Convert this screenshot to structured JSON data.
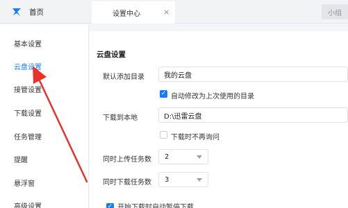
{
  "topbar": {
    "home_label": "首页",
    "tab_label": "设置中心",
    "tab_close": "×",
    "user_button": "小组"
  },
  "sidebar": {
    "items": [
      {
        "label": "基本设置"
      },
      {
        "label": "云盘设置"
      },
      {
        "label": "接管设置"
      },
      {
        "label": "下载设置"
      },
      {
        "label": "任务管理"
      },
      {
        "label": "提醒"
      },
      {
        "label": "悬浮窗"
      },
      {
        "label": "高级设置"
      }
    ],
    "active_index": 1
  },
  "cloud_settings": {
    "title": "云盘设置",
    "default_add_dir": {
      "label": "默认添加目录",
      "value": "我的云盘"
    },
    "auto_update_last_dir": {
      "label": "自动修改为上次使用的目录",
      "checked": true
    },
    "download_to_local": {
      "label": "下载到本地",
      "value": "D:\\迅雷云盘"
    },
    "no_ask_on_download": {
      "label": "下载时不再询问",
      "checked": false
    },
    "concurrent_uploads": {
      "label": "同时上传任务数",
      "value": "2"
    },
    "concurrent_downloads": {
      "label": "同时下载任务数",
      "value": "3"
    },
    "cut_off_option": {
      "text": "开始下载时自动暂停下载",
      "checked": true
    }
  },
  "colors": {
    "accent": "#1a7cf5",
    "annotation": "#e8322b"
  },
  "icons": {
    "logo": "xunlei-bird-icon",
    "close": "close-icon",
    "dropdown": "chevron-down-icon",
    "checkbox": "checkmark-icon"
  }
}
